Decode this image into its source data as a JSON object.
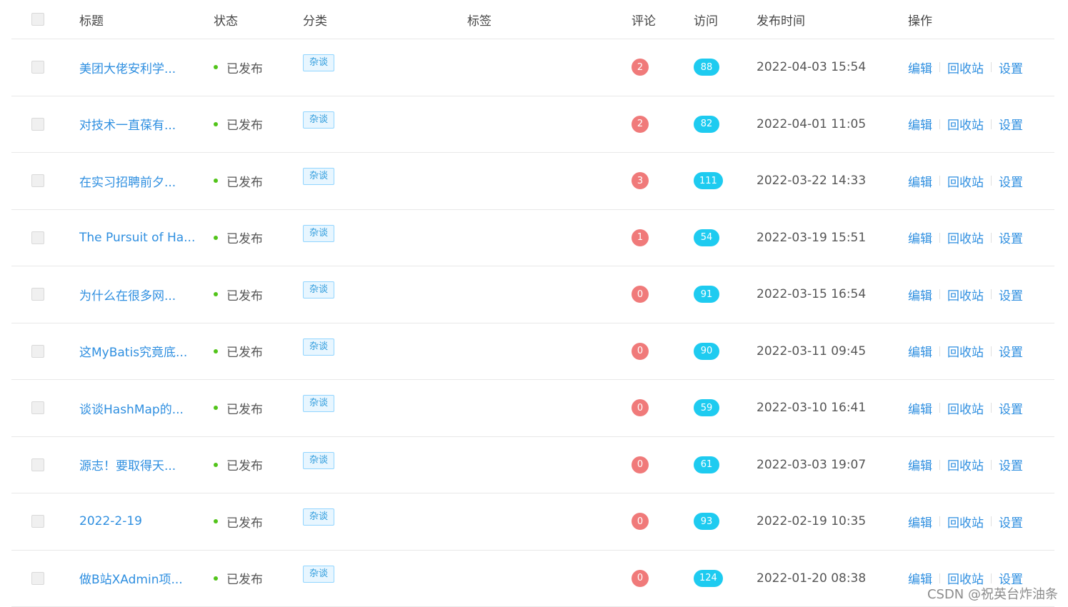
{
  "header": {
    "title": "标题",
    "status": "状态",
    "category": "分类",
    "tags": "标签",
    "comments": "评论",
    "visits": "访问",
    "publish_time": "发布时间",
    "operations": "操作"
  },
  "operations": {
    "edit": "编辑",
    "recycle": "回收站",
    "settings": "设置"
  },
  "rows": [
    {
      "title": "美团大佬安利学...",
      "status": "已发布",
      "category": "杂谈",
      "comments": "2",
      "visits": "88",
      "time": "2022-04-03 15:54"
    },
    {
      "title": "对技术一直葆有...",
      "status": "已发布",
      "category": "杂谈",
      "comments": "2",
      "visits": "82",
      "time": "2022-04-01 11:05"
    },
    {
      "title": "在实习招聘前夕...",
      "status": "已发布",
      "category": "杂谈",
      "comments": "3",
      "visits": "111",
      "time": "2022-03-22 14:33"
    },
    {
      "title": "The Pursuit of Ha...",
      "status": "已发布",
      "category": "杂谈",
      "comments": "1",
      "visits": "54",
      "time": "2022-03-19 15:51"
    },
    {
      "title": "为什么在很多网...",
      "status": "已发布",
      "category": "杂谈",
      "comments": "0",
      "visits": "91",
      "time": "2022-03-15 16:54"
    },
    {
      "title": "这MyBatis究竟底...",
      "status": "已发布",
      "category": "杂谈",
      "comments": "0",
      "visits": "90",
      "time": "2022-03-11 09:45"
    },
    {
      "title": "谈谈HashMap的...",
      "status": "已发布",
      "category": "杂谈",
      "comments": "0",
      "visits": "59",
      "time": "2022-03-10 16:41"
    },
    {
      "title": "源志！要取得天...",
      "status": "已发布",
      "category": "杂谈",
      "comments": "0",
      "visits": "61",
      "time": "2022-03-03 19:07"
    },
    {
      "title": "2022-2-19",
      "status": "已发布",
      "category": "杂谈",
      "comments": "0",
      "visits": "93",
      "time": "2022-02-19 10:35"
    },
    {
      "title": "做B站XAdmin项...",
      "status": "已发布",
      "category": "杂谈",
      "comments": "0",
      "visits": "124",
      "time": "2022-01-20 08:38"
    }
  ],
  "watermark": "CSDN @祝英台炸油条",
  "colors": {
    "link": "#2f8fe0",
    "published_dot": "#52c41a",
    "comment_badge": "#f07a7a",
    "visit_badge": "#1ecbf0",
    "tag_text": "#2d9bdc"
  }
}
